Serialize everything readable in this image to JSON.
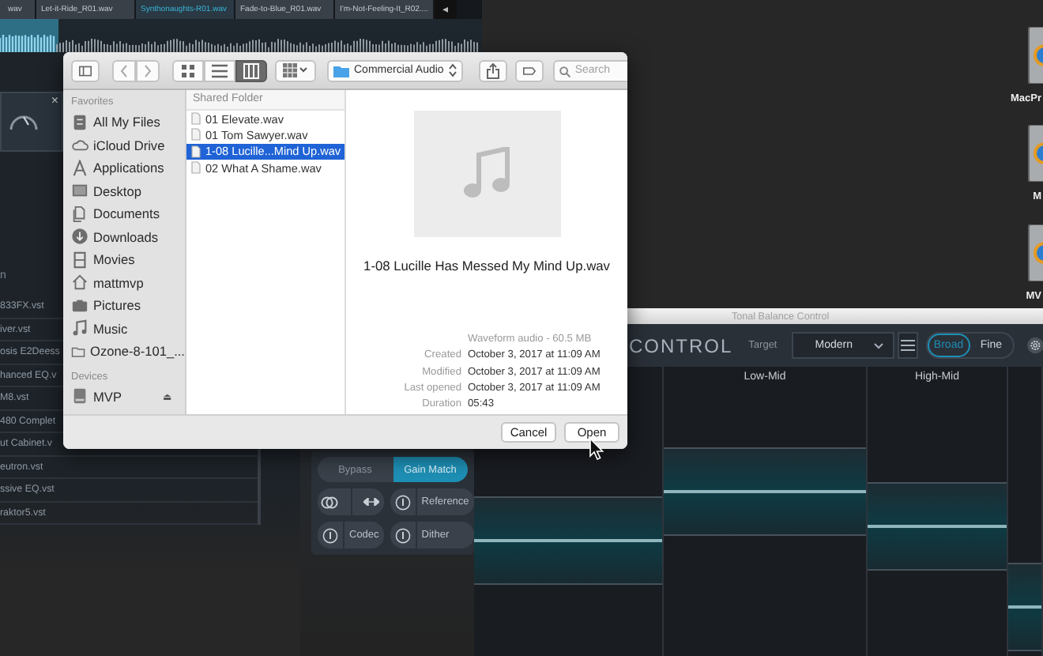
{
  "editor": {
    "tabs": [
      {
        "label": "wav",
        "selected": false
      },
      {
        "label": "Let-it-Ride_R01.wav",
        "selected": false
      },
      {
        "label": "Synthonaughts-R01.wav",
        "selected": true
      },
      {
        "label": "Fade-to-Blue_R01.wav",
        "selected": false
      },
      {
        "label": "I'm-Not-Feeling-It_R02....",
        "selected": false
      }
    ],
    "scroll_button": "◂",
    "module_close": "×",
    "plugin_list": {
      "heading": "n",
      "items": [
        "833FX.vst",
        "iver.vst",
        "osis E2Deess",
        "hanced EQ.v",
        "M8.vst",
        "480 Complet",
        "ut Cabinet.v",
        "eutron.vst",
        "ssive EQ.vst",
        "raktor5.vst"
      ]
    }
  },
  "desktop_icons": [
    {
      "label": "MacPr"
    },
    {
      "label": "M"
    },
    {
      "label": "MV"
    }
  ],
  "tonal_balance": {
    "title": "Tonal Balance Control",
    "heading": "CONTROL",
    "target_label": "Target",
    "target": "Modern",
    "modes": [
      {
        "label": "Broad",
        "selected": true
      },
      {
        "label": "Fine",
        "selected": false
      }
    ],
    "columns": [
      {
        "level": 0.4
      },
      {
        "label": "Low-Mid",
        "level": 0.57
      },
      {
        "label": "High-Mid",
        "level": 0.45
      },
      {
        "level": 0.17
      }
    ]
  },
  "ozone_panel": {
    "buttons": [
      {
        "label": "Bypass",
        "selected": false
      },
      {
        "label": "Gain Match",
        "selected": true
      }
    ],
    "modules": [
      {
        "kind": "icons"
      },
      {
        "kind": "power",
        "label": "Reference"
      },
      {
        "kind": "power",
        "label": "Codec"
      },
      {
        "kind": "power",
        "label": "Dither"
      }
    ]
  },
  "dialog": {
    "toolbar": {
      "location": "Commercial Audio",
      "search_placeholder": "Search",
      "view_modes": [
        {
          "kind": "icons",
          "selected": false
        },
        {
          "kind": "list",
          "selected": false
        },
        {
          "kind": "columns",
          "selected": true
        }
      ]
    },
    "sidebar": [
      {
        "title": "Favorites",
        "items": [
          {
            "label": "All My Files",
            "kind": "files"
          },
          {
            "label": "iCloud Drive",
            "kind": "cloud"
          },
          {
            "label": "Applications",
            "kind": "apps"
          },
          {
            "label": "Desktop",
            "kind": "desktop"
          },
          {
            "label": "Documents",
            "kind": "documents"
          },
          {
            "label": "Downloads",
            "kind": "downloads"
          },
          {
            "label": "Movies",
            "kind": "movies"
          },
          {
            "label": "mattmvp",
            "kind": "home"
          },
          {
            "label": "Pictures",
            "kind": "pictures"
          },
          {
            "label": "Music",
            "kind": "music"
          },
          {
            "label": "Ozone-8-101_...",
            "kind": "folder"
          }
        ]
      },
      {
        "title": "Devices",
        "items": [
          {
            "label": "MVP",
            "kind": "disk",
            "eject": "⏏"
          }
        ]
      }
    ],
    "column": {
      "title": "Shared Folder",
      "files": [
        {
          "name": "01 Elevate.wav",
          "selected": false
        },
        {
          "name": "01 Tom Sawyer.wav",
          "selected": false
        },
        {
          "name": "1-08 Lucille...Mind Up.wav",
          "selected": true
        },
        {
          "name": "02 What A Shame.wav",
          "selected": false
        }
      ]
    },
    "preview": {
      "filename": "1-08 Lucille Has Messed My Mind Up.wav",
      "summary": "Waveform audio - 60.5 MB",
      "info": [
        {
          "label": "Created",
          "value": "October 3, 2017 at 11:09 AM"
        },
        {
          "label": "Modified",
          "value": "October 3, 2017 at 11:09 AM"
        },
        {
          "label": "Last opened",
          "value": "October 3, 2017 at 11:09 AM"
        },
        {
          "label": "Duration",
          "value": "05:43"
        }
      ]
    },
    "buttons": [
      {
        "label": "Cancel"
      },
      {
        "label": "Open"
      }
    ]
  }
}
